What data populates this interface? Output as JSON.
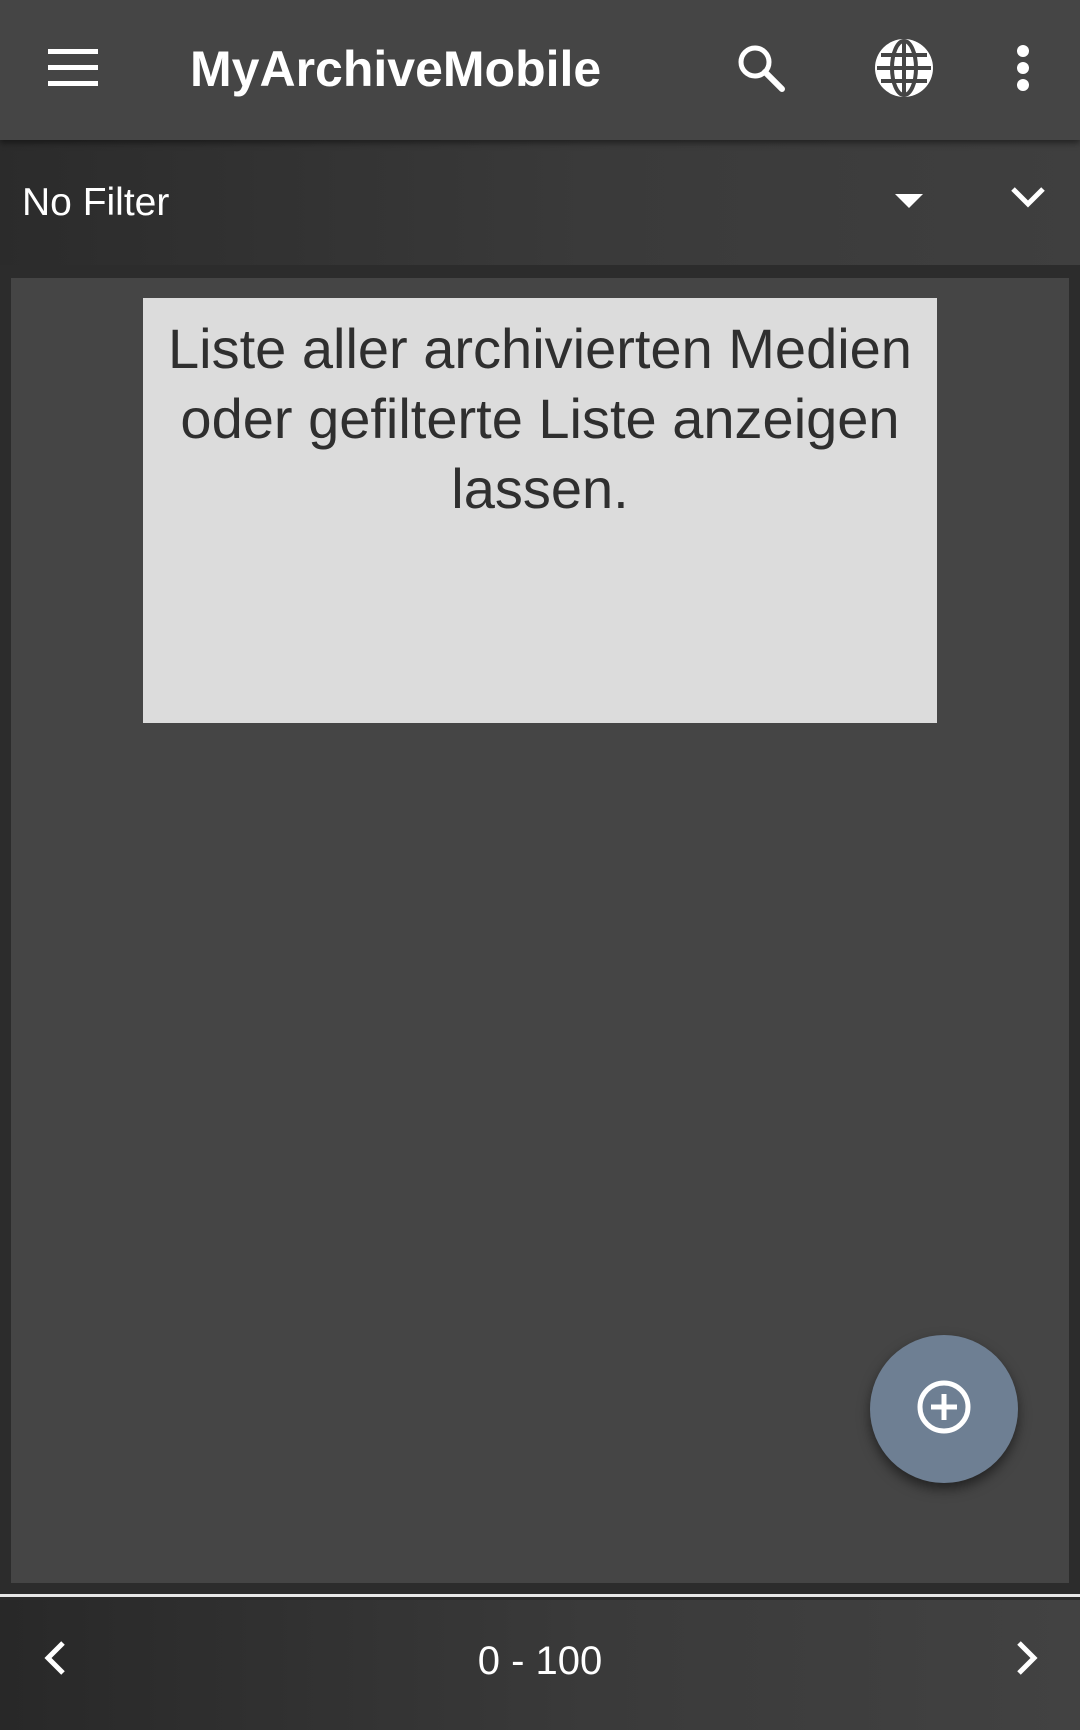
{
  "appbar": {
    "title": "MyArchiveMobile",
    "icons": {
      "menu": "hamburger-menu-icon",
      "search": "search-icon",
      "language": "globe-icon",
      "more": "more-vert-icon"
    }
  },
  "filter": {
    "selected": "No Filter",
    "icons": {
      "dropdown": "arrow-drop-down-icon",
      "expand": "chevron-down-icon"
    }
  },
  "content": {
    "info_text": "Liste aller archivierten Medien oder gefilterte Liste anzeigen lassen."
  },
  "fab": {
    "icon": "add-circle-icon",
    "color": "#6e7f93"
  },
  "pagination": {
    "range": "0 - 100",
    "icons": {
      "prev": "chevron-left-icon",
      "next": "chevron-right-icon"
    }
  },
  "colors": {
    "appbar": "#454545",
    "content_bg": "#454545",
    "card_bg": "#dcdcdc",
    "text_light": "#ffffff",
    "text_dark": "#2f2f2f"
  }
}
